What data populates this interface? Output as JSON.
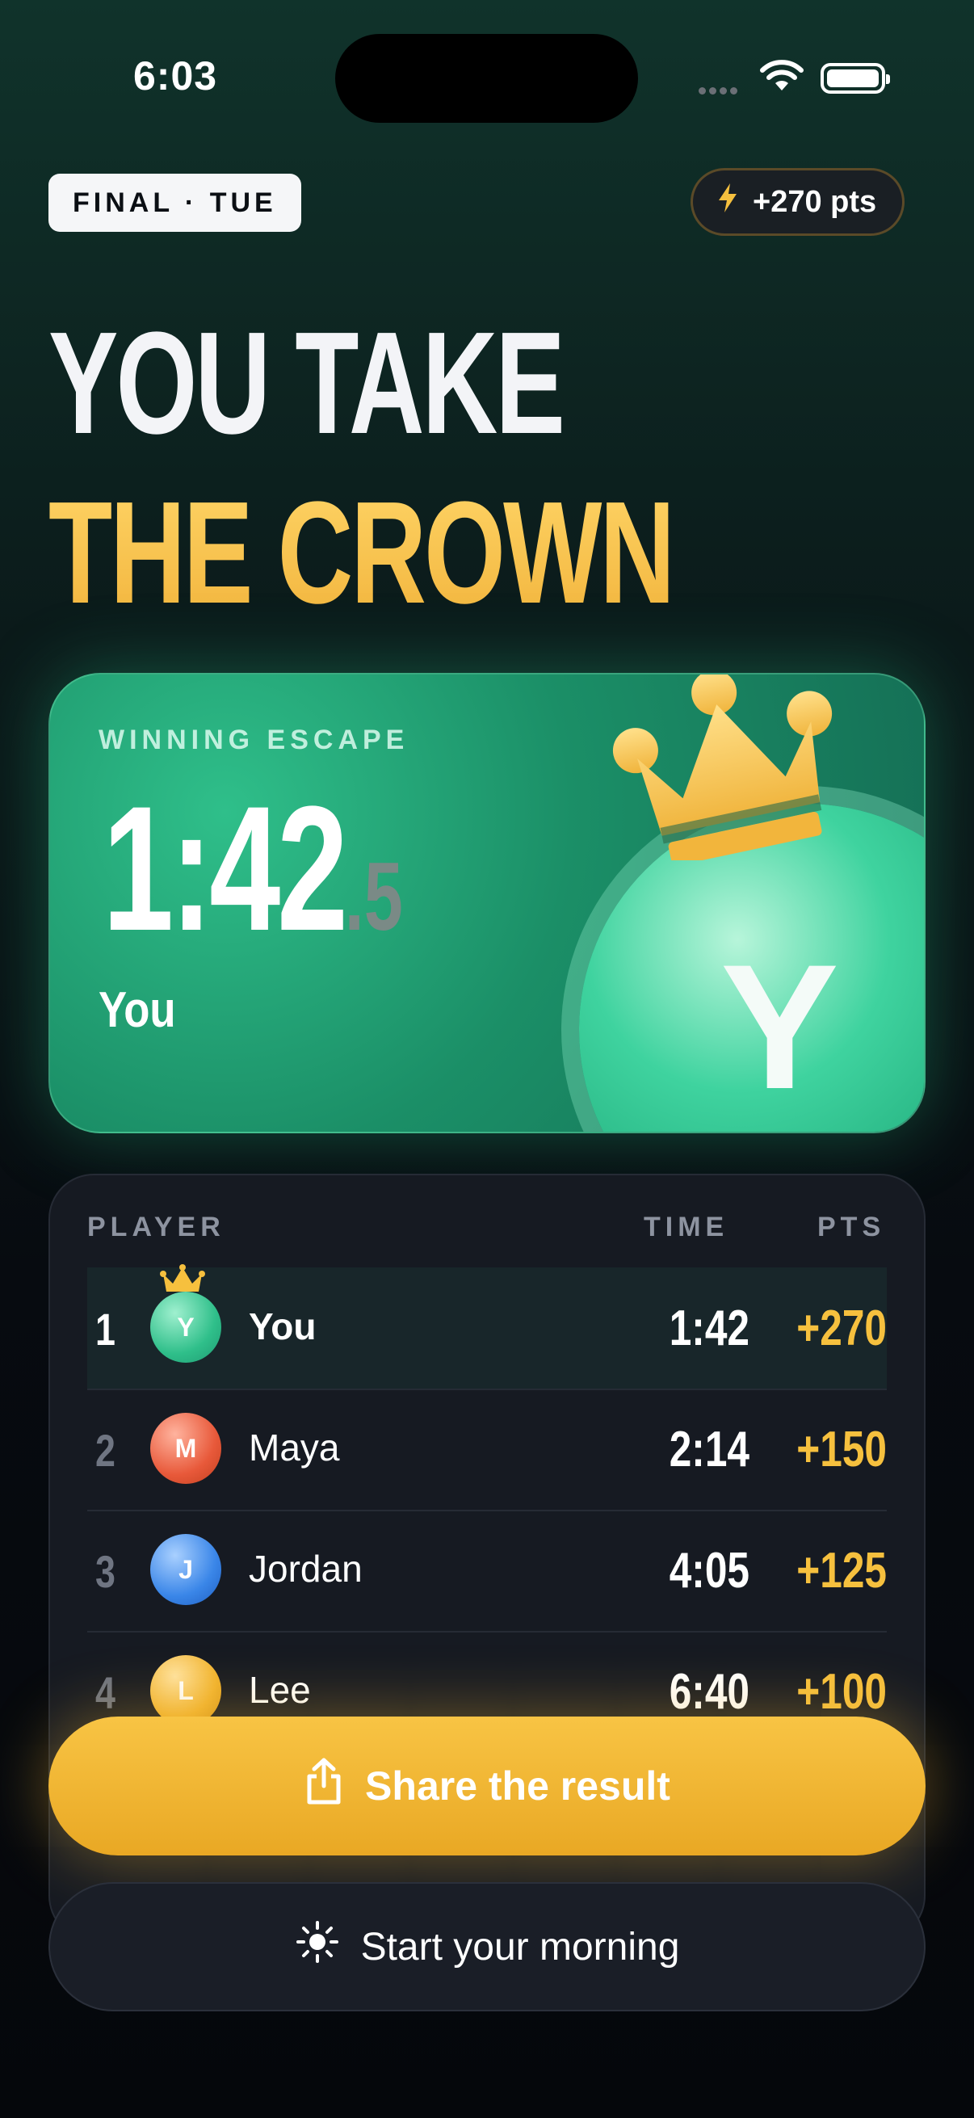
{
  "status_bar": {
    "time": "6:03"
  },
  "header": {
    "round_label": "FINAL · TUE",
    "points_badge": "+270 pts"
  },
  "headline": {
    "line1": "YOU TAKE",
    "line2": "THE CROWN"
  },
  "winner_card": {
    "label": "WINNING ESCAPE",
    "time_main": "1:42",
    "time_fraction": ".5",
    "player_name": "You",
    "avatar_initial": "Y"
  },
  "leaderboard": {
    "columns": {
      "player": "PLAYER",
      "time": "TIME",
      "pts": "PTS"
    },
    "rows": [
      {
        "rank": "1",
        "initial": "Y",
        "name": "You",
        "time": "1:42",
        "pts": "+270",
        "color": "#2fbf8a"
      },
      {
        "rank": "2",
        "initial": "M",
        "name": "Maya",
        "time": "2:14",
        "pts": "+150",
        "color": "#e8593a"
      },
      {
        "rank": "3",
        "initial": "J",
        "name": "Jordan",
        "time": "4:05",
        "pts": "+125",
        "color": "#3a86e8"
      },
      {
        "rank": "4",
        "initial": "L",
        "name": "Lee",
        "time": "6:40",
        "pts": "+100",
        "color": "#f2b531"
      }
    ]
  },
  "actions": {
    "share_label": "Share the result",
    "morning_label": "Start your morning"
  },
  "colors": {
    "accent_gold": "#f6c03e",
    "accent_green": "#2fbf8a",
    "background": "#070b10"
  }
}
